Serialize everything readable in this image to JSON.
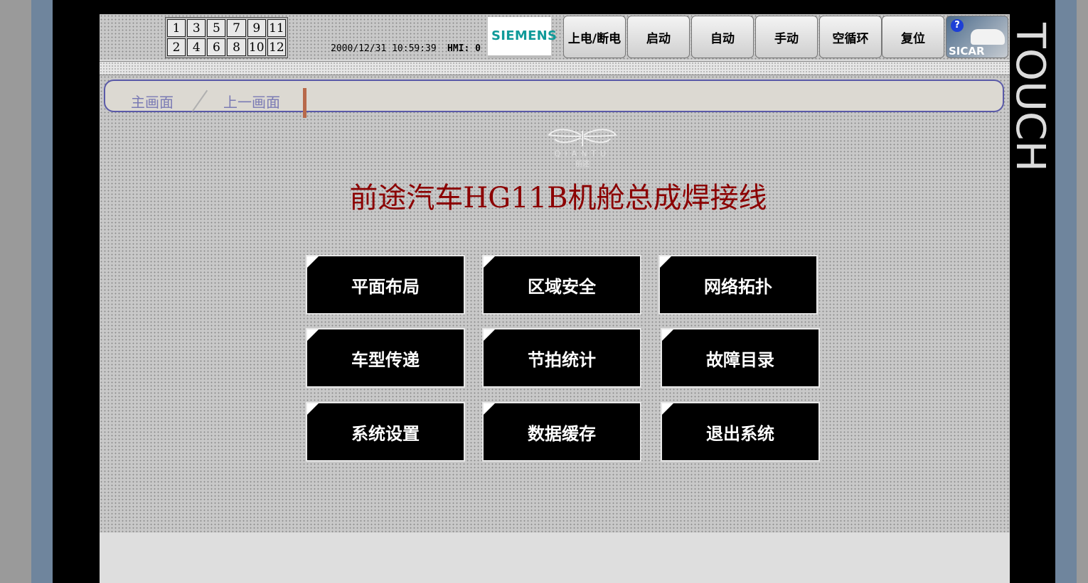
{
  "header": {
    "screen_numbers": [
      "1",
      "3",
      "5",
      "7",
      "9",
      "11",
      "2",
      "4",
      "6",
      "8",
      "10",
      "12"
    ],
    "datetime": "2000/12/31 10:59:39",
    "hmi_status": "HMI: 0",
    "brand_logo": "SIEMENS",
    "buttons": [
      "上电/断电",
      "启动",
      "自动",
      "手动",
      "空循环",
      "复位"
    ],
    "sicar": {
      "help_icon_glyph": "?",
      "label": "SICAR"
    }
  },
  "nav": {
    "home": "主画面",
    "previous": "上一画面"
  },
  "emblem": {
    "brand": "QIANTU",
    "brand_cn": "前途"
  },
  "title": "前途汽车HG11B机舱总成焊接线",
  "menu": [
    "平面布局",
    "区域安全",
    "网络拓扑",
    "车型传递",
    "节拍统计",
    "故障目录",
    "系统设置",
    "数据缓存",
    "退出系统"
  ],
  "side_label": "TOUCH",
  "colors": {
    "title": "#8b0000",
    "logo_teal": "#0f9a99",
    "nav_border": "#5a5aa8",
    "frame_blue": "#6f859d"
  }
}
